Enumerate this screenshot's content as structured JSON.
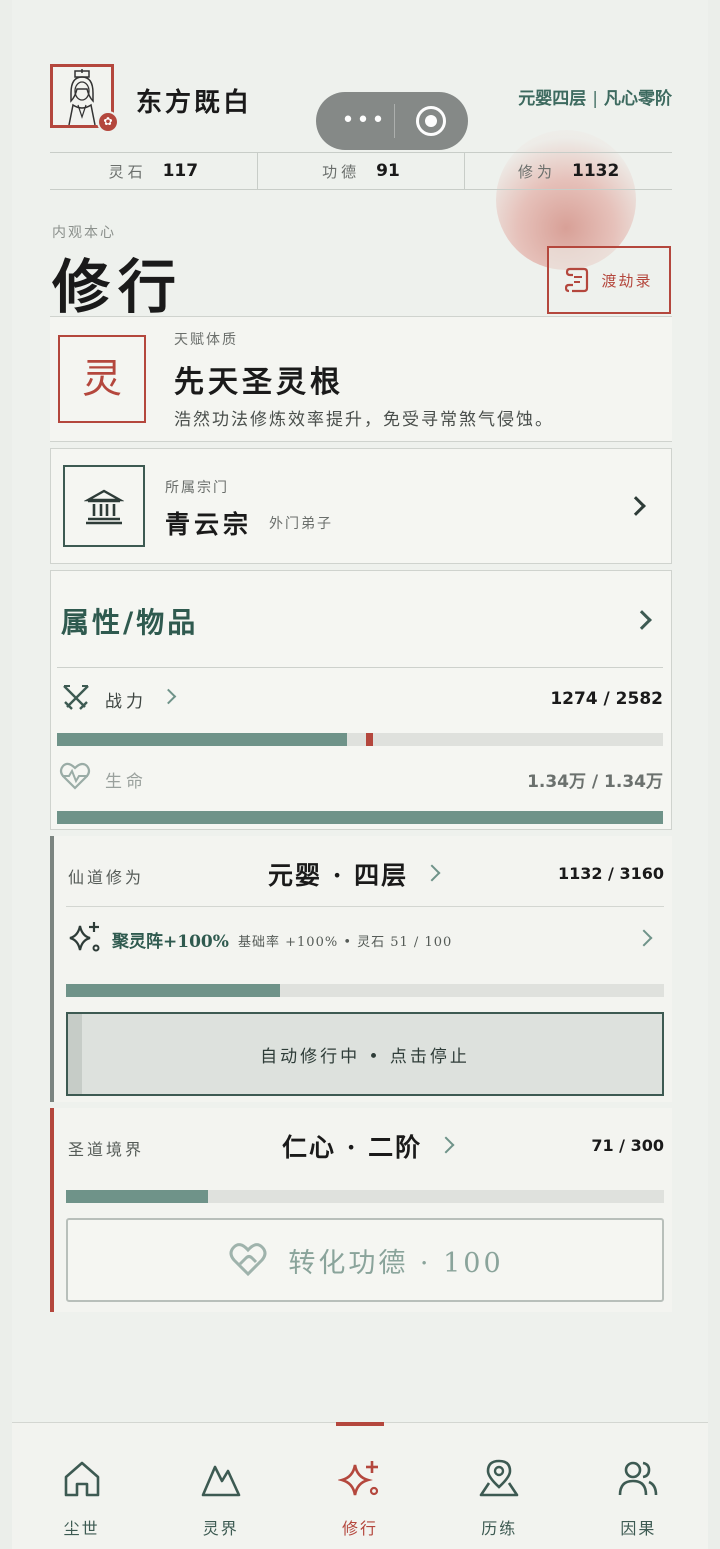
{
  "header": {
    "player_name": "东方既白",
    "realm_primary": "元婴四层",
    "realm_separator": "|",
    "realm_secondary": "凡心零阶",
    "capsule": {
      "more_icon": "more-dots-icon",
      "close_icon": "target-circle-icon"
    }
  },
  "stats": [
    {
      "label": "灵石",
      "value": "117"
    },
    {
      "label": "功德",
      "value": "91"
    },
    {
      "label": "修为",
      "value": "1132"
    }
  ],
  "section": {
    "subtitle": "内观本心",
    "title": "修行"
  },
  "dujie_button": {
    "label": "渡劫录",
    "icon": "scroll-icon"
  },
  "talent": {
    "label": "天赋体质",
    "seal": "灵",
    "name": "先天圣灵根",
    "description": "浩然功法修炼效率提升，免受寻常煞气侵蚀。"
  },
  "sect": {
    "label": "所属宗门",
    "name": "青云宗",
    "role": "外门弟子",
    "icon": "temple-icon"
  },
  "attributes": {
    "title": "属性/物品",
    "combat": {
      "label": "战力",
      "value": "1274 / 2582",
      "fill": 0.478,
      "marker": 0.51,
      "icon": "crossed-swords-icon"
    },
    "life": {
      "label": "生命",
      "value": "1.34万 / 1.34万",
      "fill": 1.0,
      "icon": "heart-pulse-icon"
    }
  },
  "cultivation": {
    "label": "仙道修为",
    "realm": "元婴 · 四层",
    "value": "1132 / 3160",
    "array_name": "聚灵阵+100%",
    "array_meta": "基础率 +100% • 灵石 51 / 100",
    "fill": 0.358,
    "auto_button": "自动修行中 • 点击停止",
    "icon": "sparkle-icon"
  },
  "saint": {
    "label": "圣道境界",
    "realm": "仁心 · 二阶",
    "value": "71 / 300",
    "fill": 0.237,
    "convert_button": "转化功德 · 100",
    "icon": "hands-heart-icon"
  },
  "nav": [
    {
      "label": "尘世",
      "icon": "home-icon",
      "active": false
    },
    {
      "label": "灵界",
      "icon": "mountain-icon",
      "active": false
    },
    {
      "label": "修行",
      "icon": "sparkle-icon",
      "active": true
    },
    {
      "label": "历练",
      "icon": "map-pin-icon",
      "active": false
    },
    {
      "label": "因果",
      "icon": "users-icon",
      "active": false
    }
  ],
  "colors": {
    "accent_red": "#b4473d",
    "accent_green": "#3d6a5f",
    "bar_fill": "#6f9389"
  }
}
